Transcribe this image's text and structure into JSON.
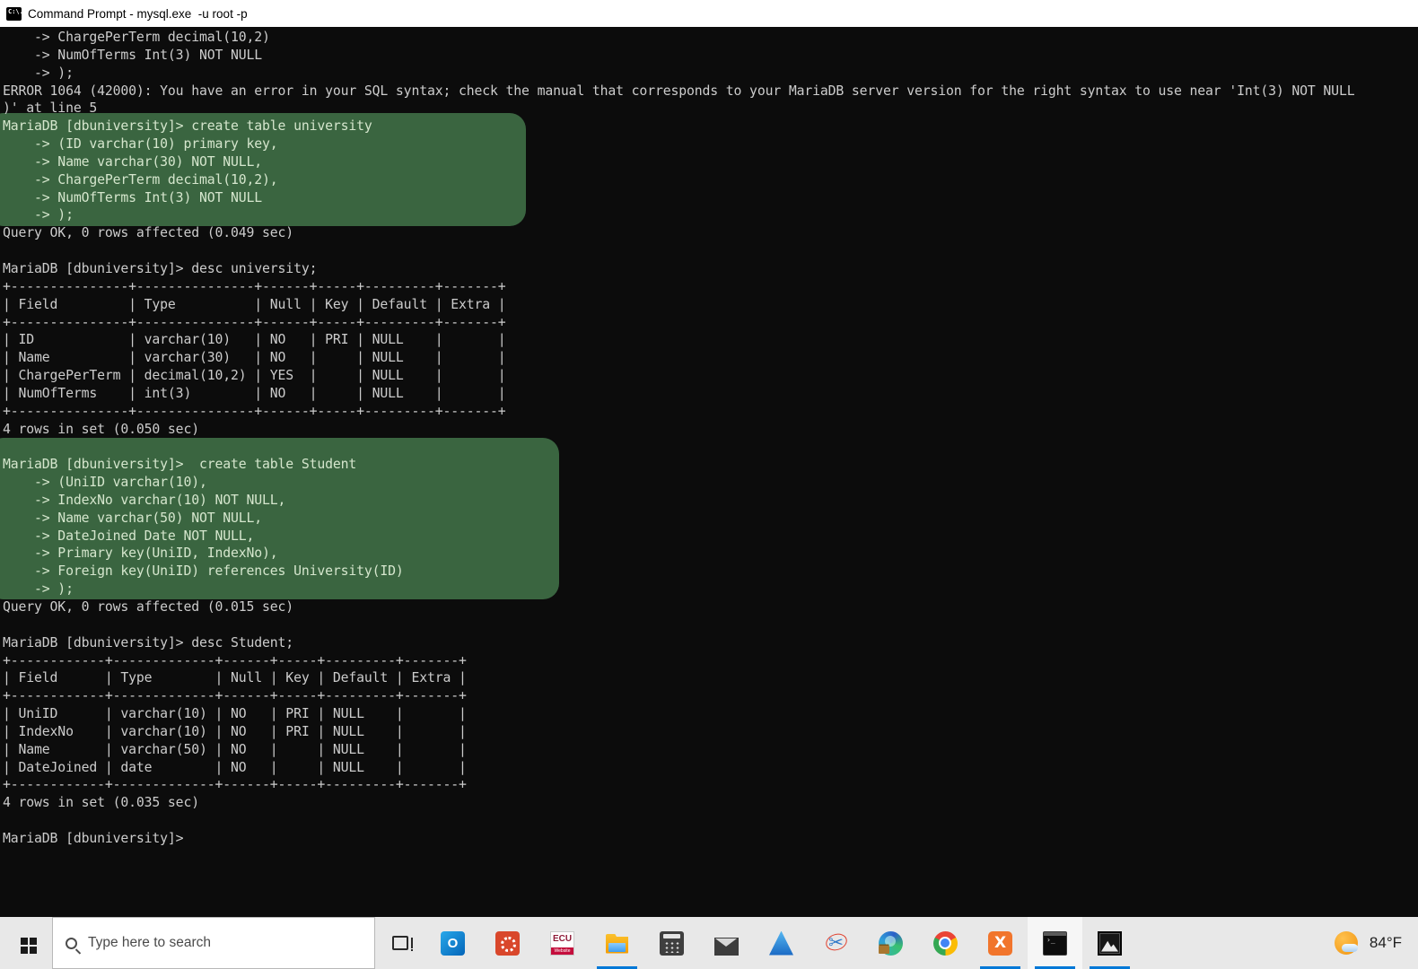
{
  "window": {
    "app": "Command Prompt",
    "title": "Command Prompt - mysql.exe  -u root -p"
  },
  "terminal": {
    "bg_color": "#0c0c0c",
    "text_color": "#cccccc",
    "highlight_color": "#3a6540",
    "lines": [
      {
        "text": "    -> ChargePerTerm decimal(10,2)",
        "hl": false
      },
      {
        "text": "    -> NumOfTerms Int(3) NOT NULL",
        "hl": false
      },
      {
        "text": "    -> );",
        "hl": false
      },
      {
        "text": "ERROR 1064 (42000): You have an error in your SQL syntax; check the manual that corresponds to your MariaDB server version for the right syntax to use near 'Int(3) NOT NULL",
        "hl": false
      },
      {
        "text": ")' at line 5",
        "hl": false
      },
      {
        "text": "MariaDB [dbuniversity]> create table university",
        "hl": true
      },
      {
        "text": "    -> (ID varchar(10) primary key,",
        "hl": true
      },
      {
        "text": "    -> Name varchar(30) NOT NULL,",
        "hl": true
      },
      {
        "text": "    -> ChargePerTerm decimal(10,2),",
        "hl": true
      },
      {
        "text": "    -> NumOfTerms Int(3) NOT NULL",
        "hl": true
      },
      {
        "text": "    -> );",
        "hl": true
      },
      {
        "text": "Query OK, 0 rows affected (0.049 sec)",
        "hl": false
      },
      {
        "text": "",
        "hl": false
      },
      {
        "text": "MariaDB [dbuniversity]> desc university;",
        "hl": false
      },
      {
        "text": "+---------------+---------------+------+-----+---------+-------+",
        "hl": false
      },
      {
        "text": "| Field         | Type          | Null | Key | Default | Extra |",
        "hl": false
      },
      {
        "text": "+---------------+---------------+------+-----+---------+-------+",
        "hl": false
      },
      {
        "text": "| ID            | varchar(10)   | NO   | PRI | NULL    |       |",
        "hl": false
      },
      {
        "text": "| Name          | varchar(30)   | NO   |     | NULL    |       |",
        "hl": false
      },
      {
        "text": "| ChargePerTerm | decimal(10,2) | YES  |     | NULL    |       |",
        "hl": false
      },
      {
        "text": "| NumOfTerms    | int(3)        | NO   |     | NULL    |       |",
        "hl": false
      },
      {
        "text": "+---------------+---------------+------+-----+---------+-------+",
        "hl": false
      },
      {
        "text": "4 rows in set (0.050 sec)",
        "hl": false
      },
      {
        "text": "",
        "hl": false
      },
      {
        "text": "MariaDB [dbuniversity]>  create table Student",
        "hl": true
      },
      {
        "text": "    -> (UniID varchar(10),",
        "hl": true
      },
      {
        "text": "    -> IndexNo varchar(10) NOT NULL,",
        "hl": true
      },
      {
        "text": "    -> Name varchar(50) NOT NULL,",
        "hl": true
      },
      {
        "text": "    -> DateJoined Date NOT NULL,",
        "hl": true
      },
      {
        "text": "    -> Primary key(UniID, IndexNo),",
        "hl": true
      },
      {
        "text": "    -> Foreign key(UniID) references University(ID)",
        "hl": true
      },
      {
        "text": "    -> );",
        "hl": true
      },
      {
        "text": "Query OK, 0 rows affected (0.015 sec)",
        "hl": false
      },
      {
        "text": "",
        "hl": false
      },
      {
        "text": "MariaDB [dbuniversity]> desc Student;",
        "hl": false
      },
      {
        "text": "+------------+-------------+------+-----+---------+-------+",
        "hl": false
      },
      {
        "text": "| Field      | Type        | Null | Key | Default | Extra |",
        "hl": false
      },
      {
        "text": "+------------+-------------+------+-----+---------+-------+",
        "hl": false
      },
      {
        "text": "| UniID      | varchar(10) | NO   | PRI | NULL    |       |",
        "hl": false
      },
      {
        "text": "| IndexNo    | varchar(10) | NO   | PRI | NULL    |       |",
        "hl": false
      },
      {
        "text": "| Name       | varchar(50) | NO   |     | NULL    |       |",
        "hl": false
      },
      {
        "text": "| DateJoined | date        | NO   |     | NULL    |       |",
        "hl": false
      },
      {
        "text": "+------------+-------------+------+-----+---------+-------+",
        "hl": false
      },
      {
        "text": "4 rows in set (0.035 sec)",
        "hl": false
      },
      {
        "text": "",
        "hl": false
      },
      {
        "text": "MariaDB [dbuniversity]>",
        "hl": false
      }
    ]
  },
  "taskbar": {
    "search_placeholder": "Type here to search",
    "accent_color": "#0078d7",
    "apps": [
      {
        "id": "outlook",
        "name": "Outlook",
        "open": false,
        "active": false
      },
      {
        "id": "canvas",
        "name": "Canvas",
        "open": false,
        "active": false
      },
      {
        "id": "ecu",
        "name": "ECU Website",
        "open": false,
        "active": false
      },
      {
        "id": "explorer",
        "name": "File Explorer",
        "open": true,
        "active": false
      },
      {
        "id": "calculator",
        "name": "Calculator",
        "open": false,
        "active": false
      },
      {
        "id": "mail",
        "name": "Mail",
        "open": false,
        "active": false
      },
      {
        "id": "azure",
        "name": "Azure",
        "open": false,
        "active": false
      },
      {
        "id": "snip",
        "name": "Snipping Tool",
        "open": false,
        "active": false
      },
      {
        "id": "edge",
        "name": "Microsoft Edge",
        "open": false,
        "active": false
      },
      {
        "id": "chrome",
        "name": "Google Chrome",
        "open": false,
        "active": false
      },
      {
        "id": "xampp",
        "name": "XAMPP",
        "open": true,
        "active": false
      },
      {
        "id": "cmd",
        "name": "Command Prompt",
        "open": true,
        "active": true
      },
      {
        "id": "photos",
        "name": "Photos",
        "open": true,
        "active": false
      }
    ],
    "weather_temp": "84°F"
  }
}
